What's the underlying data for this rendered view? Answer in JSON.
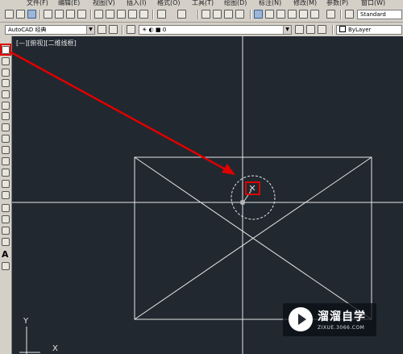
{
  "menubar": {
    "items": [
      "文件(F)",
      "编辑(E)",
      "视图(V)",
      "插入(I)",
      "格式(O)",
      "工具(T)",
      "绘图(D)",
      "标注(N)",
      "修改(M)",
      "参数(P)",
      "窗口(W)"
    ]
  },
  "toolbar": {
    "workspace_value": "AutoCAD 经典",
    "layer_value": "0",
    "color_value": "ByLayer",
    "style_value": "Standard"
  },
  "viewport": {
    "label": "[—][俯视][二维线框]"
  },
  "ucs": {
    "y_label": "Y",
    "x_label": "X"
  },
  "watermark": {
    "title": "溜溜自学",
    "url": "ZIXUE.3066.COM"
  },
  "colors": {
    "canvas_bg": "#212830",
    "annotation_red": "#e00000",
    "geometry_white": "#e6e6e6"
  }
}
